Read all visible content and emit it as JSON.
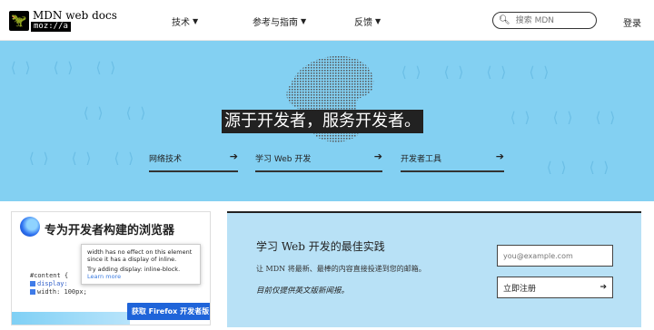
{
  "header": {
    "logo_text": "MDN web docs",
    "logo_sub": "moz://a",
    "nav": [
      {
        "label": "技术"
      },
      {
        "label": "参考与指南"
      },
      {
        "label": "反馈"
      }
    ],
    "search_placeholder": "搜索 MDN",
    "login": "登录"
  },
  "hero": {
    "slogan": "源于开发者，服务开发者。",
    "links": [
      {
        "label": "网络技术"
      },
      {
        "label": "学习 Web 开发"
      },
      {
        "label": "开发者工具"
      }
    ]
  },
  "ad": {
    "title": "专为开发者构建的浏览器",
    "tooltip_line1": "width has no effect on this element since it has a display of inline.",
    "tooltip_line2": "Try adding display: inline-block.",
    "tooltip_link": "Learn more",
    "code_selector": "#content {",
    "code_prop1": "display: ",
    "code_prop2": "width: 100px;",
    "button": "获取 Firefox 开发者版"
  },
  "newsletter": {
    "title": "学习 Web 开发的最佳实践",
    "desc": "让 MDN 将最新、最棒的内容直接投递到您的邮箱。",
    "note": "目前仅提供英文版新闻报。",
    "email_placeholder": "you@example.com",
    "signup": "立即注册"
  },
  "colors": {
    "hero_bg": "#83d0f2",
    "newsletter_bg": "#b8e1f6",
    "button_blue": "#1f64d9"
  }
}
